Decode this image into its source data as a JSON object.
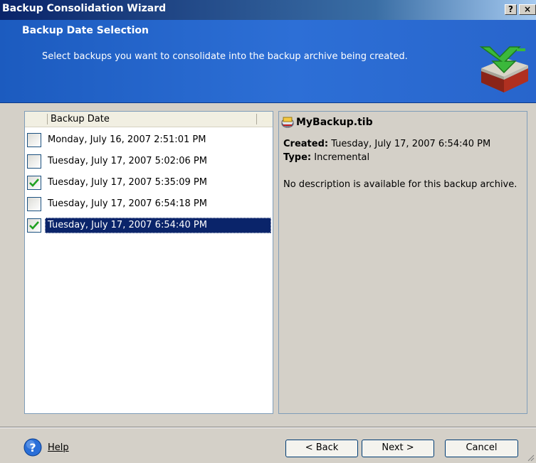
{
  "window": {
    "title": "Backup Consolidation Wizard",
    "help_btn": "?",
    "close_btn": "×"
  },
  "header": {
    "title": "Backup Date Selection",
    "subtitle": "Select backups you want to consolidate into the backup archive being created."
  },
  "list": {
    "column_header": "Backup Date",
    "items": [
      {
        "label": "Monday, July 16, 2007 2:51:01 PM",
        "checked": false,
        "selected": false
      },
      {
        "label": "Tuesday, July 17, 2007 5:02:06 PM",
        "checked": false,
        "selected": false
      },
      {
        "label": "Tuesday, July 17, 2007 5:35:09 PM",
        "checked": true,
        "selected": false
      },
      {
        "label": "Tuesday, July 17, 2007 6:54:18 PM",
        "checked": false,
        "selected": false
      },
      {
        "label": "Tuesday, July 17, 2007 6:54:40 PM",
        "checked": true,
        "selected": true
      }
    ]
  },
  "details": {
    "filename": "MyBackup.tib",
    "created_label": "Created:",
    "created_value": "Tuesday, July 17, 2007 6:54:40 PM",
    "type_label": "Type:",
    "type_value": "Incremental",
    "description": "No description is available for this backup archive."
  },
  "footer": {
    "help": "Help",
    "back": "< Back",
    "next": "Next >",
    "cancel": "Cancel"
  },
  "colors": {
    "header_blue": "#2d6fd6",
    "selection": "#0a246a",
    "check_green": "#21a121"
  },
  "icons": [
    "help-circle-icon",
    "backup-archive-icon",
    "consolidate-logo-icon",
    "checkmark-icon"
  ]
}
